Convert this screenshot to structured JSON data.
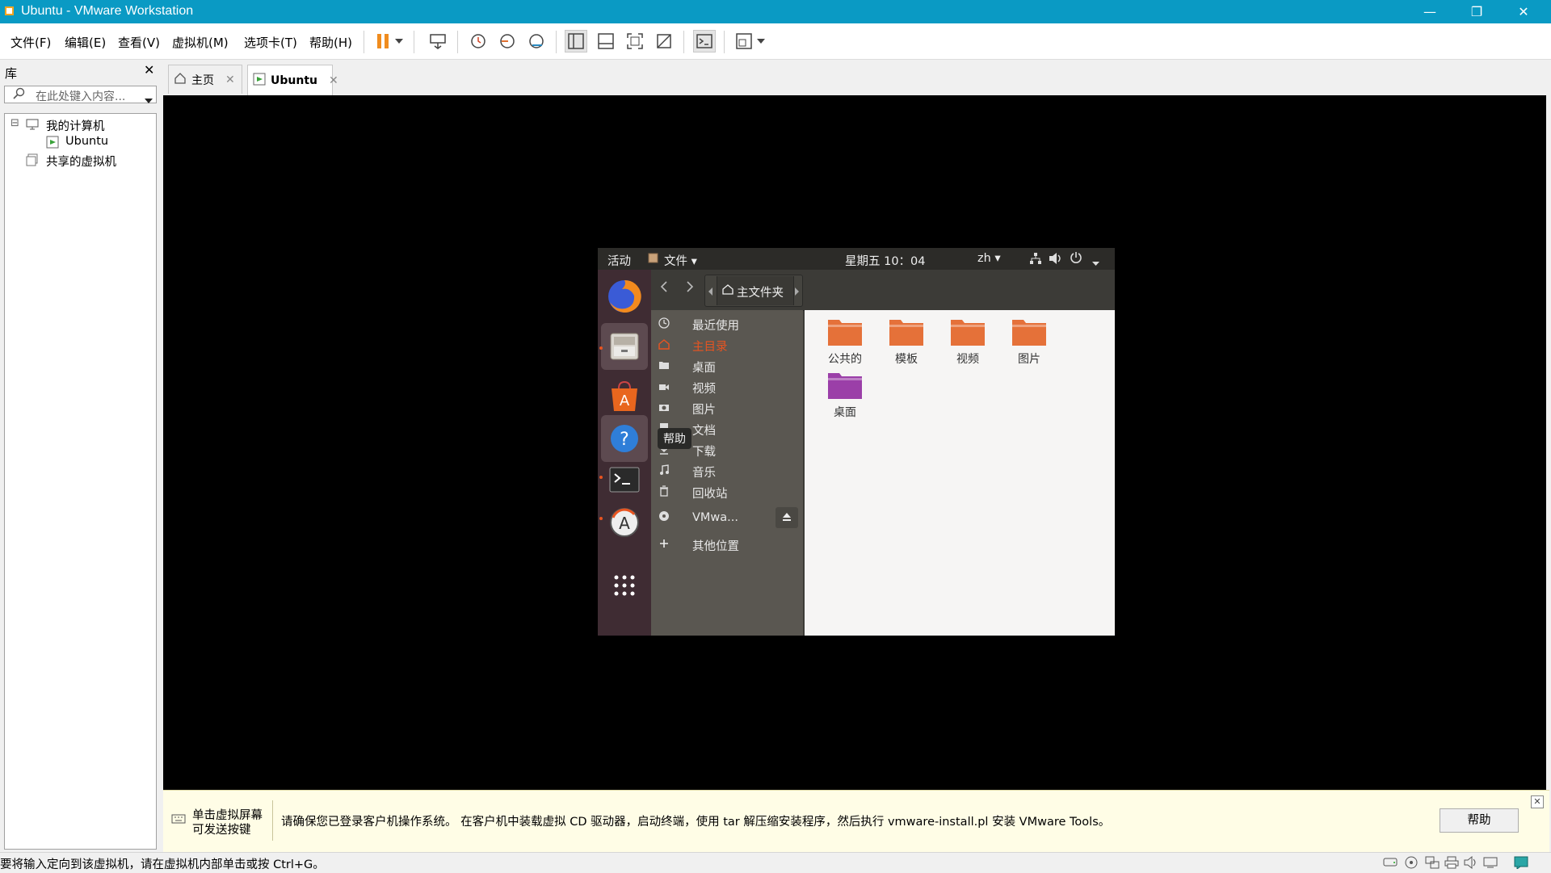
{
  "window": {
    "title": "Ubuntu - VMware Workstation",
    "controls": {
      "minimize": "—",
      "restore": "❐",
      "close": "✕"
    }
  },
  "menu": [
    "文件(F)",
    "编辑(E)",
    "查看(V)",
    "虚拟机(M)",
    "选项卡(T)",
    "帮助(H)"
  ],
  "library": {
    "title": "库",
    "close": "✕",
    "search_placeholder": "在此处键入内容...",
    "tree": {
      "my_computer": "我的计算机",
      "vm": "Ubuntu",
      "shared": "共享的虚拟机",
      "expander": "⊟"
    }
  },
  "tabs": [
    {
      "label": "主页",
      "close": "✕"
    },
    {
      "label": "Ubuntu",
      "close": "✕"
    }
  ],
  "guest": {
    "topbar": {
      "activities": "活动",
      "app_menu": "文件 ▾",
      "clock": "星期五 10：04",
      "lang": "zh ▾"
    },
    "nautilus": {
      "path": "主文件夹",
      "sidebar": [
        {
          "icon": "clock-icon",
          "label": "最近使用"
        },
        {
          "icon": "home-icon",
          "label": "主目录",
          "active": true
        },
        {
          "icon": "folder-icon",
          "label": "桌面"
        },
        {
          "icon": "video-icon",
          "label": "视频"
        },
        {
          "icon": "camera-icon",
          "label": "图片"
        },
        {
          "icon": "document-icon",
          "label": "文档"
        },
        {
          "icon": "download-icon",
          "label": "下载"
        },
        {
          "icon": "music-icon",
          "label": "音乐"
        },
        {
          "icon": "trash-icon",
          "label": "回收站"
        },
        {
          "icon": "disc-icon",
          "label": "VMwa..."
        },
        {
          "icon": "plus-icon",
          "label": "其他位置"
        }
      ],
      "folders": [
        {
          "label": "公共的",
          "color": "#e5713a"
        },
        {
          "label": "模板",
          "color": "#e5713a"
        },
        {
          "label": "视频",
          "color": "#e5713a"
        },
        {
          "label": "图片",
          "color": "#e5713a"
        },
        {
          "label": "桌面",
          "color": "#9b3fa8"
        }
      ]
    },
    "tooltip": "帮助"
  },
  "notification": {
    "hint": [
      "单击虚拟屏幕",
      "可发送按键"
    ],
    "message": "请确保您已登录客户机操作系统。 在客户机中装载虚拟 CD 驱动器，启动终端，使用 tar 解压缩安装程序，然后执行 vmware-install.pl 安装 VMware Tools。",
    "help_button": "帮助",
    "close": "✕"
  },
  "status": {
    "text": "要将输入定向到该虚拟机，请在虚拟机内部单击或按 Ctrl+G。"
  },
  "colors": {
    "titlebar": "#0a9ac4",
    "accent_orange": "#e95420",
    "pause_orange": "#f08c1e"
  }
}
